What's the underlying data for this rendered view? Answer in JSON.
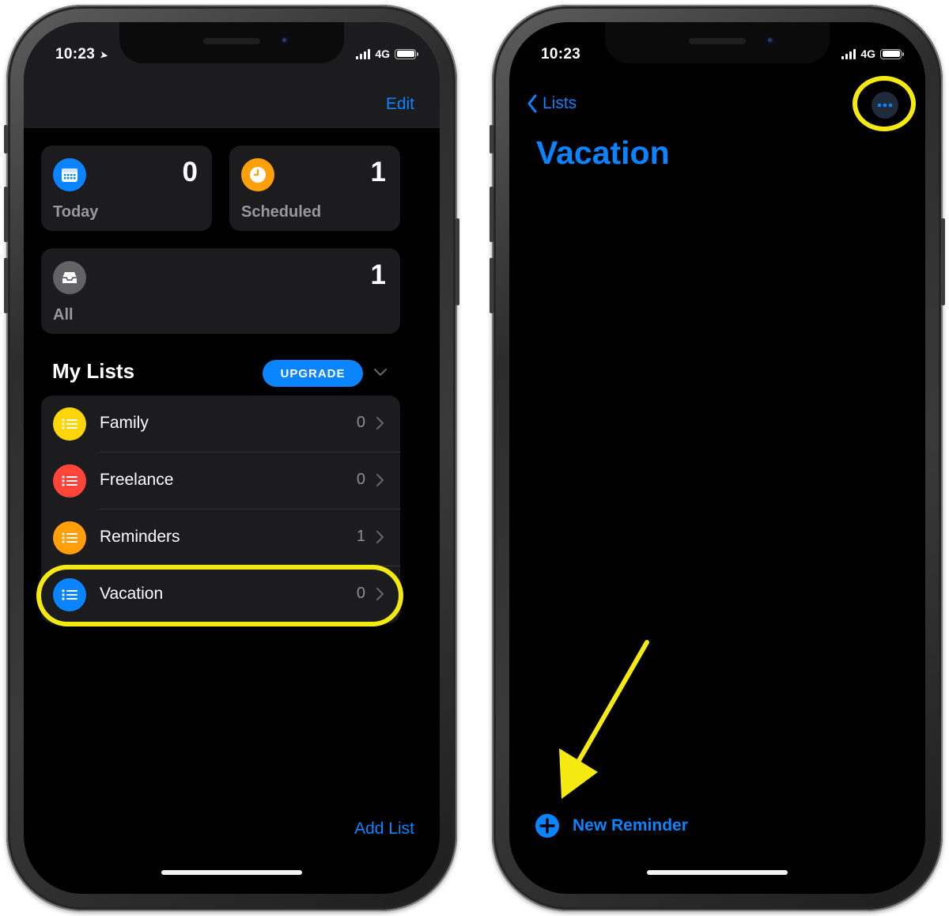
{
  "left": {
    "status": {
      "time": "10:23",
      "network": "4G"
    },
    "nav": {
      "edit": "Edit"
    },
    "smart_lists": {
      "today": {
        "label": "Today",
        "count": "0",
        "color": "#0a84ff",
        "icon": "calendar-icon"
      },
      "scheduled": {
        "label": "Scheduled",
        "count": "1",
        "color": "#ff9f0a",
        "icon": "clock-icon"
      },
      "all": {
        "label": "All",
        "count": "1",
        "color": "#636366",
        "icon": "tray-icon"
      }
    },
    "my_lists": {
      "title": "My Lists",
      "upgrade": "UPGRADE",
      "items": [
        {
          "name": "Family",
          "count": "0",
          "color": "#ffd60a"
        },
        {
          "name": "Freelance",
          "count": "0",
          "color": "#ff453a"
        },
        {
          "name": "Reminders",
          "count": "1",
          "color": "#ff9f0a"
        },
        {
          "name": "Vacation",
          "count": "0",
          "color": "#0a84ff"
        }
      ]
    },
    "add_list": "Add List"
  },
  "right": {
    "status": {
      "time": "10:23",
      "network": "4G"
    },
    "back_label": "Lists",
    "list_title": "Vacation",
    "new_reminder": "New Reminder"
  },
  "colors": {
    "accent": "#0a84ff",
    "highlight": "#f4ea12",
    "tile_bg": "#1c1c1e"
  }
}
